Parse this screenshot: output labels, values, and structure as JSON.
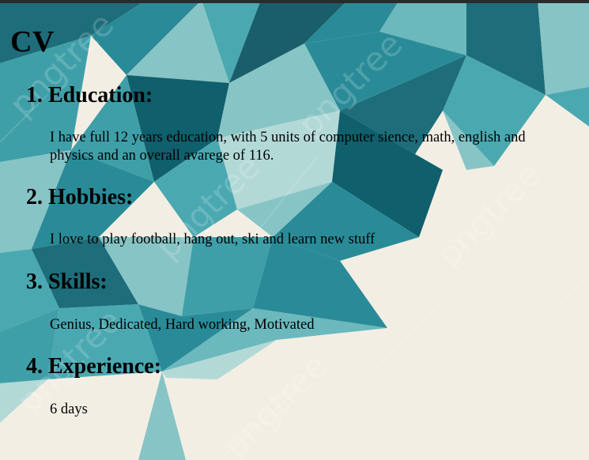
{
  "page": {
    "title": "CV"
  },
  "sections": [
    {
      "title": "1. Education:",
      "text": "I have full 12 years education, with 5 units of computer sience, math, english and physics and an overall avarege of 116."
    },
    {
      "title": "2. Hobbies:",
      "text": "I love to play football, hang out, ski and learn new stuff"
    },
    {
      "title": "3. Skills:",
      "text": "Genius, Dedicated, Hard working, Motivated"
    },
    {
      "title": "4. Experience:",
      "text": "6 days"
    }
  ],
  "background": {
    "watermark": "pngtree",
    "colors": {
      "cream": "#f3eee4",
      "teal_dark": "#0f5f6c",
      "teal": "#2a8b98",
      "teal_mid": "#4aa8b1",
      "teal_light": "#87c4c6",
      "teal_pale": "#b3d9d7"
    }
  }
}
